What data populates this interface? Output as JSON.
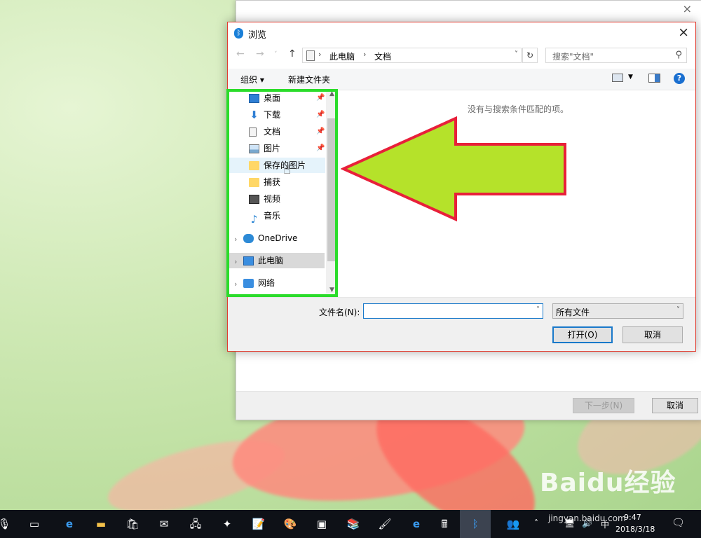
{
  "background_window": {
    "close_label": "×",
    "next_label": "下一步(N)",
    "cancel_label": "取消"
  },
  "dialog": {
    "title": "浏览",
    "close_label": "×",
    "nav": {
      "back": "←",
      "forward": "→",
      "dropdown": "˅",
      "up": "↑"
    },
    "address": {
      "crumbs": [
        "此电脑",
        "文档"
      ],
      "separator": "›"
    },
    "refresh": "↻",
    "search_placeholder": "搜索\"文档\"",
    "toolbar": {
      "organize": "组织 ▾",
      "new_folder": "新建文件夹",
      "help": "?"
    },
    "nav_pane": {
      "quick_access": [
        {
          "label": "桌面",
          "icon": "desktop-icon",
          "pinned": true
        },
        {
          "label": "下载",
          "icon": "download-icon",
          "pinned": true
        },
        {
          "label": "文档",
          "icon": "document-icon",
          "pinned": true
        },
        {
          "label": "图片",
          "icon": "pictures-icon",
          "pinned": true
        },
        {
          "label": "保存的图片",
          "icon": "folder-icon",
          "pinned": false
        },
        {
          "label": "捕获",
          "icon": "folder-icon",
          "pinned": false
        },
        {
          "label": "视频",
          "icon": "video-icon",
          "pinned": false
        },
        {
          "label": "音乐",
          "icon": "music-icon",
          "pinned": false
        }
      ],
      "roots": [
        {
          "label": "OneDrive",
          "icon": "onedrive-icon"
        },
        {
          "label": "此电脑",
          "icon": "this-pc-icon",
          "selected": true
        },
        {
          "label": "网络",
          "icon": "network-icon"
        }
      ]
    },
    "empty_message": "没有与搜索条件匹配的项。",
    "filename_label": "文件名(N):",
    "filename_value": "",
    "filetype_value": "所有文件",
    "open_label": "打开(O)",
    "cancel_label": "取消"
  },
  "annotation": {
    "highlight_color": "#2bdc2b",
    "arrow_fill": "#b5e22a",
    "arrow_stroke": "#e8203a"
  },
  "taskbar": {
    "clock_time": "9:47",
    "clock_date": "2018/3/18",
    "ime": "中",
    "watermark": "Baidu经验",
    "watermark_url": "jingyan.baidu.com"
  }
}
